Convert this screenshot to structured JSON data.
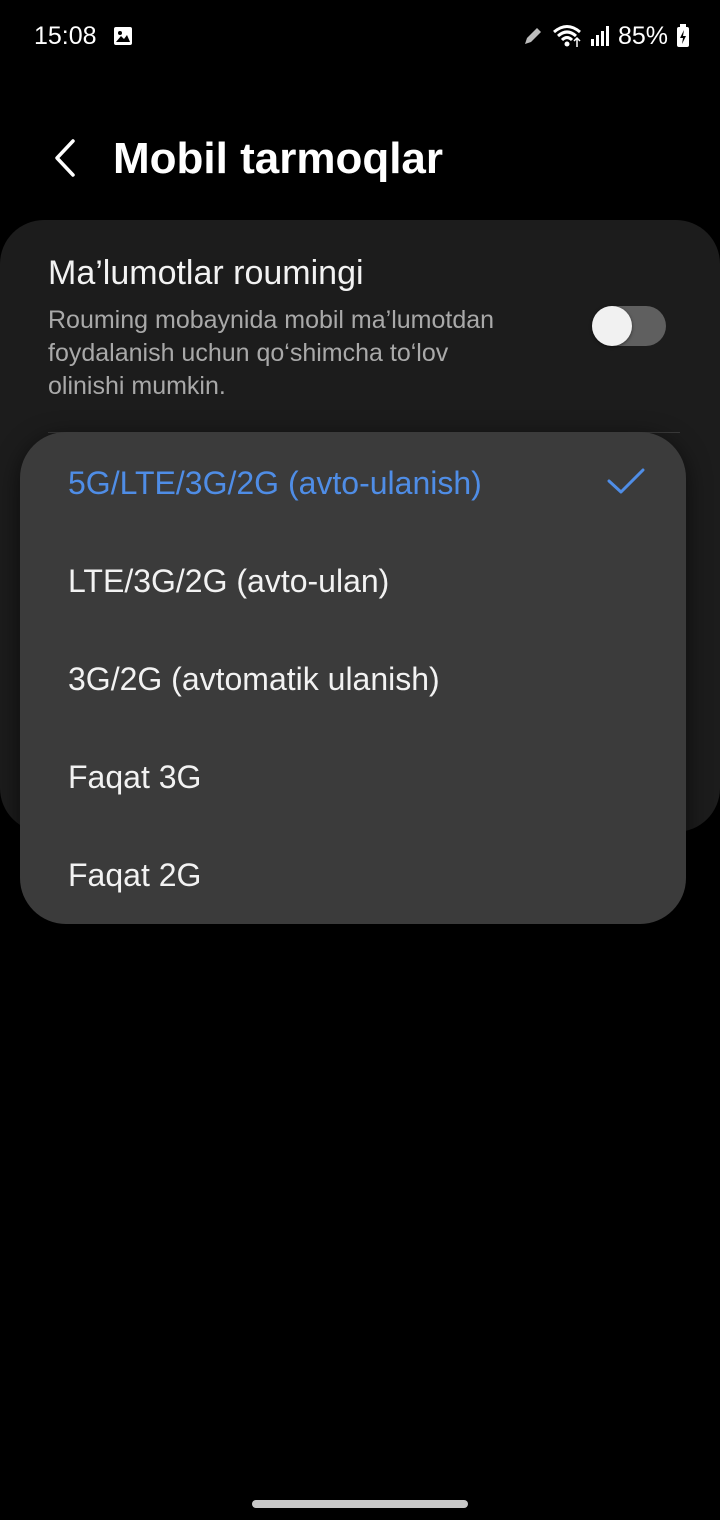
{
  "status_bar": {
    "time": "15:08",
    "battery": "85%",
    "icons": [
      "gallery-icon",
      "pen-icon",
      "wifi-icon",
      "signal-icon",
      "battery-icon"
    ]
  },
  "header": {
    "title": "Mobil tarmoqlar",
    "back_icon": "chevron-left-icon"
  },
  "roaming": {
    "title": "Ma’lumotlar roumingi",
    "description": "Rouming mobaynida mobil ma’lumotdan foydalanish uchun qo‘shimcha to‘lov olinishi mumkin.",
    "toggle_on": false
  },
  "network_mode_menu": {
    "options": [
      {
        "label": "5G/LTE/3G/2G (avto-ulanish)",
        "selected": true
      },
      {
        "label": "LTE/3G/2G (avto-ulan)",
        "selected": false
      },
      {
        "label": "3G/2G (avtomatik ulanish)",
        "selected": false
      },
      {
        "label": "Faqat 3G",
        "selected": false
      },
      {
        "label": "Faqat 2G",
        "selected": false
      }
    ]
  },
  "colors": {
    "accent": "#4f8de6",
    "background": "#000000",
    "card": "#1c1c1c",
    "popup": "#3b3b3b"
  }
}
